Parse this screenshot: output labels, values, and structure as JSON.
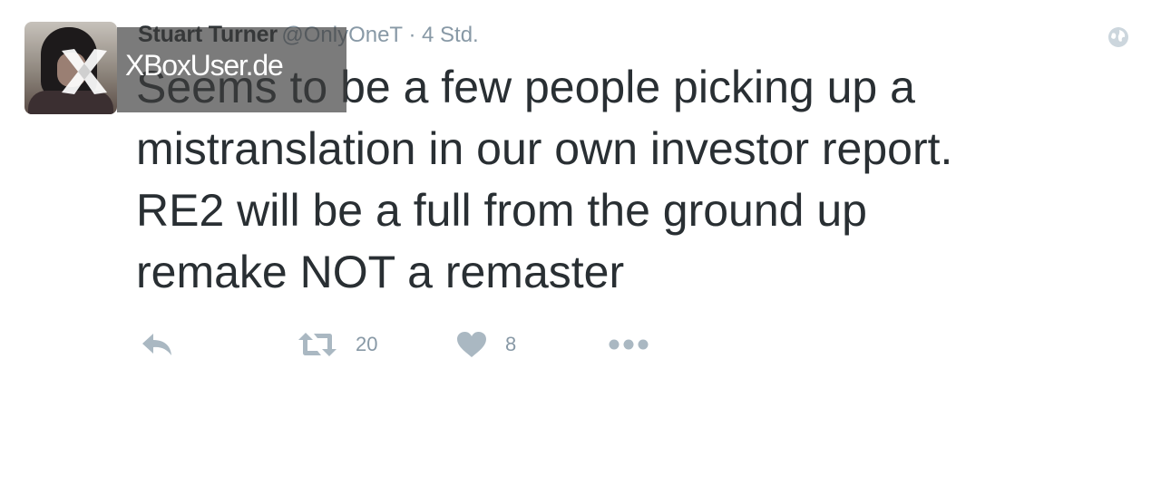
{
  "tweet": {
    "author": {
      "name": "Stuart Turner",
      "handle": "@OnlyOneT",
      "separator": "·",
      "time": "4 Std."
    },
    "text_lines": [
      "Seems to be a few people picking up a",
      "mistranslation in our own investor report.",
      "RE2 will be a full from the ground up",
      "remake NOT a remaster"
    ],
    "actions": {
      "reply_icon": "reply-icon",
      "retweet_icon": "retweet-icon",
      "retweet_count": "20",
      "like_icon": "heart-icon",
      "like_count": "8",
      "more_icon": "more-dots-icon"
    },
    "globe_icon": "globe-icon"
  },
  "watermark": {
    "text": "XBoxUser.de",
    "logo_icon": "xbox-x-logo"
  },
  "colors": {
    "text": "#292f33",
    "muted": "#8899a6",
    "icon": "#aab8c2",
    "background": "#ffffff"
  }
}
